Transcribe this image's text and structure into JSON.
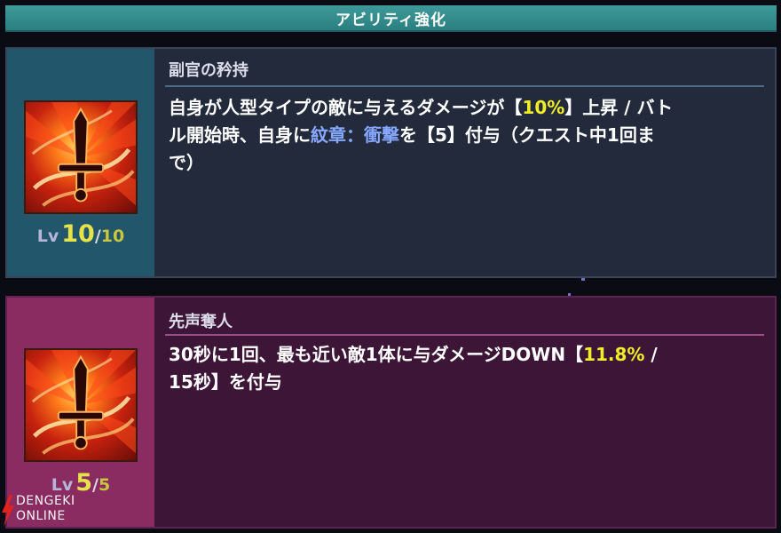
{
  "header": {
    "title": "アビリティ強化"
  },
  "abilities": [
    {
      "name": "副官の矜持",
      "level_label": "Lv",
      "level_current": "10",
      "level_separator": "/",
      "level_max": "10",
      "description": {
        "p1": "自身が人型タイプの敵に与えるダメージが【",
        "p2": "10%",
        "p3": "】上昇 / バト\nル開始時、自身に",
        "p4": "紋章：衝撃",
        "p5": "を【5】付与（クエスト中1回ま\nで）"
      }
    },
    {
      "name": "先声奪人",
      "level_label": "Lv",
      "level_current": "5",
      "level_separator": "/",
      "level_max": "5",
      "description": {
        "p1": "30秒に1回、最も近い敵1体に与ダメージDOWN【",
        "p2": "11.8%",
        "p3": " /\n15秒】を付与"
      }
    }
  ],
  "watermark": {
    "line1": "DENGEKI",
    "line2": "ONLINE"
  },
  "colors": {
    "header": "#2b7f80",
    "card1_side": "#22566a",
    "card2_side": "#8a2c62",
    "highlight_value": "#f0ee28",
    "highlight_term": "#86a8ff",
    "level_current": "#e5e24a"
  },
  "icons": [
    "sword-emblem-icon",
    "dengeki-bolt-icon"
  ]
}
